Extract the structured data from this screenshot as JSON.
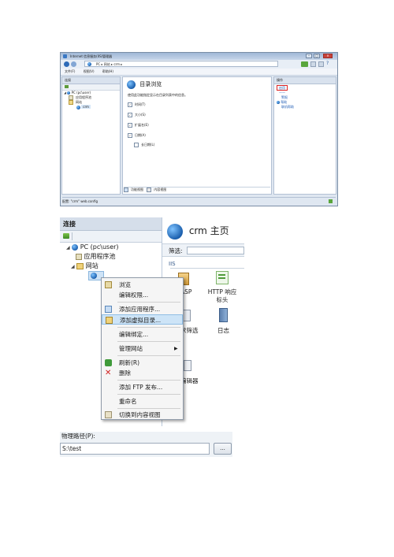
{
  "window1": {
    "title": "Internet 信息服务(IIS)管理器",
    "address_segments": [
      "PC",
      "网站",
      "crm"
    ],
    "menu": [
      "文件(F)",
      "视图(V)",
      "帮助(H)"
    ],
    "connections_header": "连接",
    "tree": {
      "server": "PC (pc\\user)",
      "app_pools": "应用程序池",
      "sites": "网站",
      "site": "crm"
    },
    "feature": {
      "title": "目录浏览",
      "description": "使用此功能指定显示在目录列表中的信息。",
      "options": [
        {
          "label": "时间(T)",
          "checked": true
        },
        {
          "label": "大小(S)",
          "checked": true
        },
        {
          "label": "扩展名(E)",
          "checked": true
        },
        {
          "label": "日期(A)",
          "checked": true
        },
        {
          "label": "长日期(L)",
          "checked": false
        }
      ]
    },
    "bottom_tabs": [
      "功能视图",
      "内容视图"
    ],
    "actions_header": "操作",
    "actions": {
      "enable": "启用",
      "alerts": "警报",
      "help": "帮助",
      "online_help": "联机帮助"
    },
    "status": "配置: \"crm\" web.config"
  },
  "window2": {
    "connections_header": "连接",
    "tree": {
      "server": "PC (pc\\user)",
      "app_pools": "应用程序池",
      "sites": "网站"
    },
    "home_title": "crm 主页",
    "filter_label": "筛选:",
    "group_label": "IIS",
    "features": [
      {
        "label": "ASP",
        "icon": "asp-icon"
      },
      {
        "label": "HTTP 响应标头",
        "icon": "http-headers-icon"
      },
      {
        "label": "求筛选",
        "icon": "request-filter-icon"
      },
      {
        "label": "日志",
        "icon": "log-icon"
      },
      {
        "label": "编辑器",
        "icon": "editor-icon"
      }
    ],
    "context_menu": [
      {
        "label": "浏览",
        "icon": "browse-icon",
        "highlighted": false
      },
      {
        "label": "编辑权限...",
        "icon": "",
        "highlighted": false
      },
      {
        "label": "添加应用程序...",
        "icon": "add-app-icon",
        "highlighted": false
      },
      {
        "label": "添加虚拟目录...",
        "icon": "add-vdir-icon",
        "highlighted": true
      },
      {
        "label": "编辑绑定...",
        "icon": "",
        "highlighted": false
      },
      {
        "label": "管理网站",
        "icon": "",
        "highlighted": false,
        "submenu": true
      },
      {
        "label": "刷新(R)",
        "icon": "refresh-icon",
        "highlighted": false
      },
      {
        "label": "删除",
        "icon": "delete-icon",
        "highlighted": false
      },
      {
        "label": "添加 FTP 发布...",
        "icon": "",
        "highlighted": false
      },
      {
        "label": "重命名",
        "icon": "",
        "highlighted": false
      },
      {
        "label": "切换到内容视图",
        "icon": "content-view-icon",
        "highlighted": false
      }
    ]
  },
  "window3": {
    "label": "物理路径(P):",
    "value": "S:\\test",
    "browse_button": "..."
  }
}
